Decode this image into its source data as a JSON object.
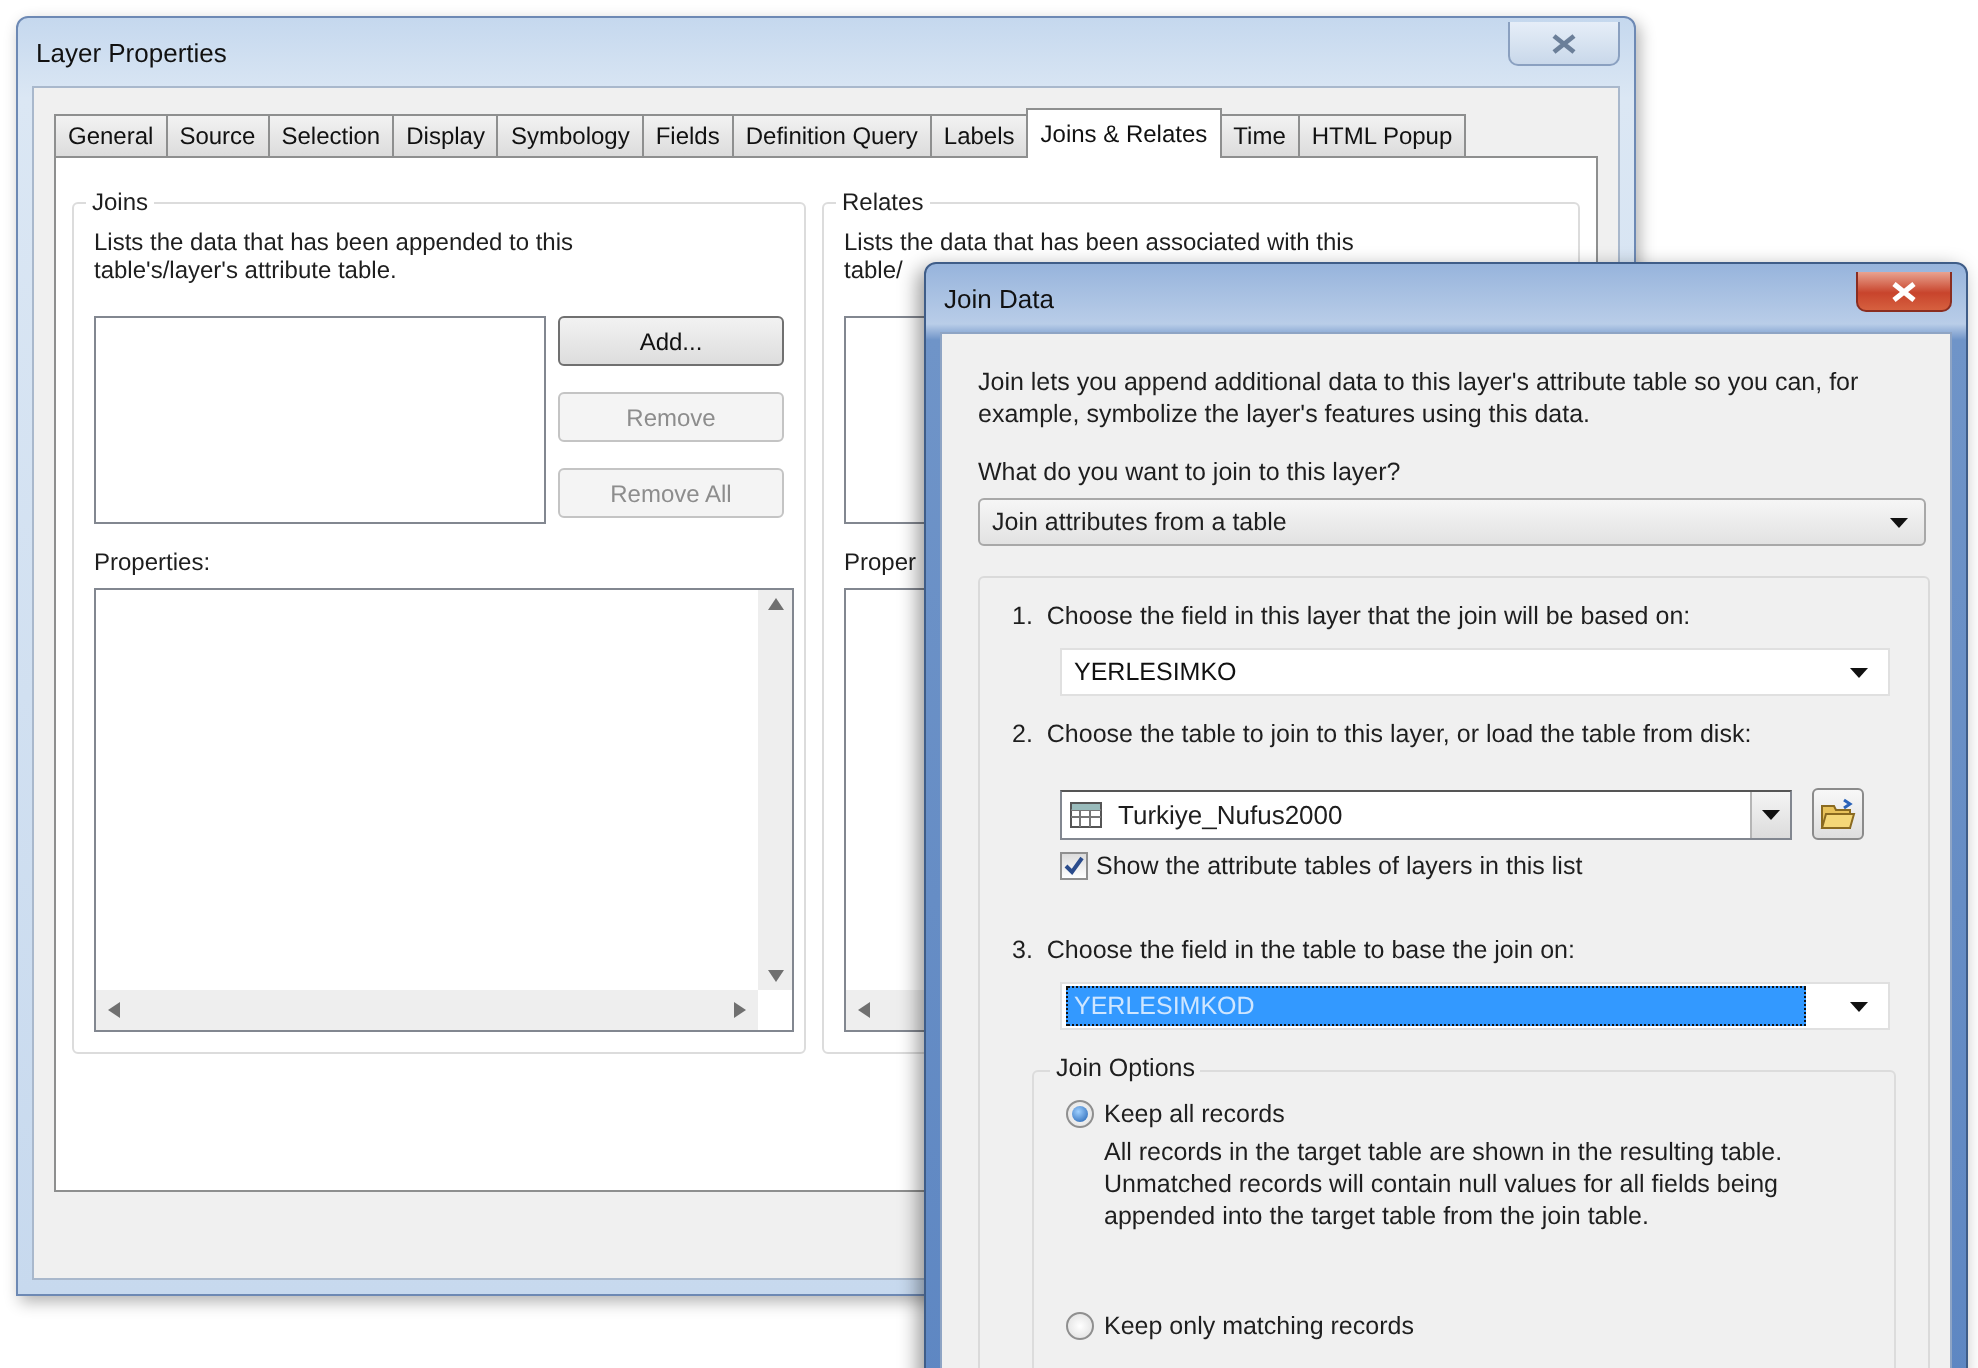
{
  "layer_properties": {
    "title": "Layer Properties",
    "tabs": [
      {
        "label": "General",
        "selected": false
      },
      {
        "label": "Source",
        "selected": false
      },
      {
        "label": "Selection",
        "selected": false
      },
      {
        "label": "Display",
        "selected": false
      },
      {
        "label": "Symbology",
        "selected": false
      },
      {
        "label": "Fields",
        "selected": false
      },
      {
        "label": "Definition Query",
        "selected": false
      },
      {
        "label": "Labels",
        "selected": false
      },
      {
        "label": "Joins & Relates",
        "selected": true
      },
      {
        "label": "Time",
        "selected": false
      },
      {
        "label": "HTML Popup",
        "selected": false
      }
    ],
    "joins": {
      "heading": "Joins",
      "description_lines": [
        "Lists the data that has been appended to this",
        "table's/layer's attribute table."
      ],
      "buttons": [
        {
          "label": "Add...",
          "disabled": false
        },
        {
          "label": "Remove",
          "disabled": true
        },
        {
          "label": "Remove All",
          "disabled": true
        }
      ],
      "properties_label": "Properties:"
    },
    "relates": {
      "heading": "Relates",
      "description_lines": [
        "Lists the data that has been associated with this",
        "table/"
      ],
      "properties_label": "Proper"
    }
  },
  "join_data": {
    "title": "Join Data",
    "intro": "Join lets you append additional data to this layer's attribute table so you can, for example, symbolize the layer's features using this data.",
    "question": "What do you want to join to this layer?",
    "join_type": "Join attributes from a table",
    "steps": [
      {
        "number": "1.",
        "label": "Choose the field in this layer that the join will be based on:",
        "kind": "field",
        "value": "YERLESIMKO"
      },
      {
        "number": "2.",
        "label": "Choose the table to join to this layer, or load the table from disk:",
        "kind": "table",
        "value": "Turkiye_Nufus2000",
        "checkbox": {
          "label": "Show the attribute tables of layers in this list",
          "checked": true
        }
      },
      {
        "number": "3.",
        "label": "Choose the field in the table to base the join on:",
        "kind": "field",
        "value": "YERLESIMKOD",
        "focused": true
      }
    ],
    "join_options": {
      "heading": "Join Options",
      "options": [
        {
          "label": "Keep all records",
          "selected": true,
          "description": "All records in the target table are shown in the resulting table. Unmatched records will contain null values for all fields being appended into the target table from the join table."
        },
        {
          "label": "Keep only matching records",
          "selected": false
        }
      ]
    }
  }
}
